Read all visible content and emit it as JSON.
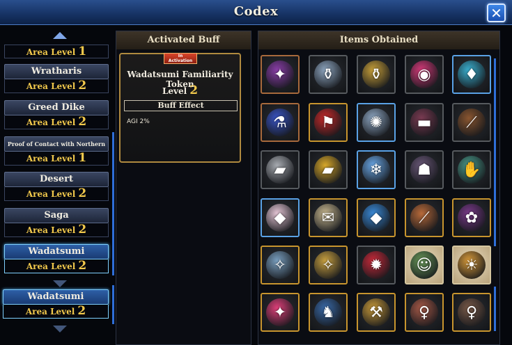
{
  "window": {
    "title": "Codex"
  },
  "area_list": {
    "level_label": "Area Level",
    "items": [
      {
        "name": "",
        "level": "1",
        "selected": false,
        "partial": true
      },
      {
        "name": "Wratharis",
        "level": "2",
        "selected": false
      },
      {
        "name": "Greed Dike",
        "level": "2",
        "selected": false
      },
      {
        "name": "Proof of Contact with Northern Pride",
        "level": "1",
        "selected": false,
        "small": true
      },
      {
        "name": "Desert",
        "level": "2",
        "selected": false
      },
      {
        "name": "Saga",
        "level": "2",
        "selected": false
      },
      {
        "name": "Wadatsumi",
        "level": "2",
        "selected": true
      }
    ],
    "ghost_item": {
      "name": "Wadatsumi",
      "level": "2"
    }
  },
  "buff_panel": {
    "header": "Activated Buff",
    "badge_top": "In",
    "badge_bottom": "Activation",
    "name": "Wadatsumi Familiarity Token",
    "level_label": "Level",
    "level_value": "2",
    "effect_header": "Buff Effect",
    "effect_text": "AGI 2%"
  },
  "items_panel": {
    "header": "Items Obtained",
    "items": [
      {
        "name": "scepter-icon",
        "frame": "copper",
        "glyph": "✦",
        "color": "#8a3ea8"
      },
      {
        "name": "silver-jug-icon",
        "frame": "gray",
        "glyph": "⚱",
        "color": "#8ea6c0"
      },
      {
        "name": "gold-jug-icon",
        "frame": "gray",
        "glyph": "⚱",
        "color": "#c9a13a"
      },
      {
        "name": "cushion-icon",
        "frame": "gray",
        "glyph": "◉",
        "color": "#d63a7a"
      },
      {
        "name": "crystal-cluster-icon",
        "frame": "blue",
        "glyph": "♦",
        "color": "#3ab0d0"
      },
      {
        "name": "potion-staff-icon",
        "frame": "copper",
        "glyph": "⚗",
        "color": "#3a56c8"
      },
      {
        "name": "red-banner-icon",
        "frame": "gold",
        "glyph": "⚑",
        "color": "#c82a2a"
      },
      {
        "name": "magic-seal-icon",
        "frame": "blue",
        "glyph": "✺",
        "color": "#8fa8c4"
      },
      {
        "name": "anvil-icon",
        "frame": "gray",
        "glyph": "▬",
        "color": "#7a3b52"
      },
      {
        "name": "branch-icon",
        "frame": "gray",
        "glyph": "⟋",
        "color": "#8a5630"
      },
      {
        "name": "silver-ingot-icon",
        "frame": "gray",
        "glyph": "▰",
        "color": "#a8acb2"
      },
      {
        "name": "gold-ingot-icon",
        "frame": "gray",
        "glyph": "▰",
        "color": "#d8a82a"
      },
      {
        "name": "ice-apple-icon",
        "frame": "blue",
        "glyph": "❄",
        "color": "#6aa8e8"
      },
      {
        "name": "hooded-figure-icon",
        "frame": "gray",
        "glyph": "☗",
        "color": "#6a5878"
      },
      {
        "name": "gauntlet-icon",
        "frame": "gray",
        "glyph": "✋",
        "color": "#4a9a8a"
      },
      {
        "name": "prism-crystal-icon",
        "frame": "blue",
        "glyph": "◆",
        "color": "#e8c8d8"
      },
      {
        "name": "scroll-icon",
        "frame": "gold",
        "glyph": "✉",
        "color": "#c8b890"
      },
      {
        "name": "blue-gem-icon",
        "frame": "gold",
        "glyph": "◆",
        "color": "#3a8ad8"
      },
      {
        "name": "rod-icon",
        "frame": "gold",
        "glyph": "⟋",
        "color": "#b86a3a"
      },
      {
        "name": "ribbon-icon",
        "frame": "gold",
        "glyph": "✿",
        "color": "#7a3a8a"
      },
      {
        "name": "silver-compass-icon",
        "frame": "gold",
        "glyph": "✧",
        "color": "#7aa0c0"
      },
      {
        "name": "gold-compass-icon",
        "frame": "gold",
        "glyph": "✧",
        "color": "#c8a040"
      },
      {
        "name": "ruby-medallion-icon",
        "frame": "gray",
        "glyph": "✹",
        "color": "#c82a3a"
      },
      {
        "name": "cat-badge-icon",
        "frame": "cream",
        "glyph": "☺",
        "color": "#6a9a5a"
      },
      {
        "name": "gold-badge-icon",
        "frame": "cream",
        "glyph": "☀",
        "color": "#d89a3a"
      },
      {
        "name": "pink-shard-icon",
        "frame": "gold",
        "glyph": "✦",
        "color": "#e0407a"
      },
      {
        "name": "figure-icon",
        "frame": "gold",
        "glyph": "♞",
        "color": "#3a6aa8"
      },
      {
        "name": "hammer-icon",
        "frame": "gold",
        "glyph": "⚒",
        "color": "#c89a3a"
      },
      {
        "name": "portrait-girl-1-icon",
        "frame": "gold",
        "glyph": "♀",
        "color": "#a85a48"
      },
      {
        "name": "portrait-girl-2-icon",
        "frame": "gold",
        "glyph": "♀",
        "color": "#7a5a48"
      }
    ]
  }
}
